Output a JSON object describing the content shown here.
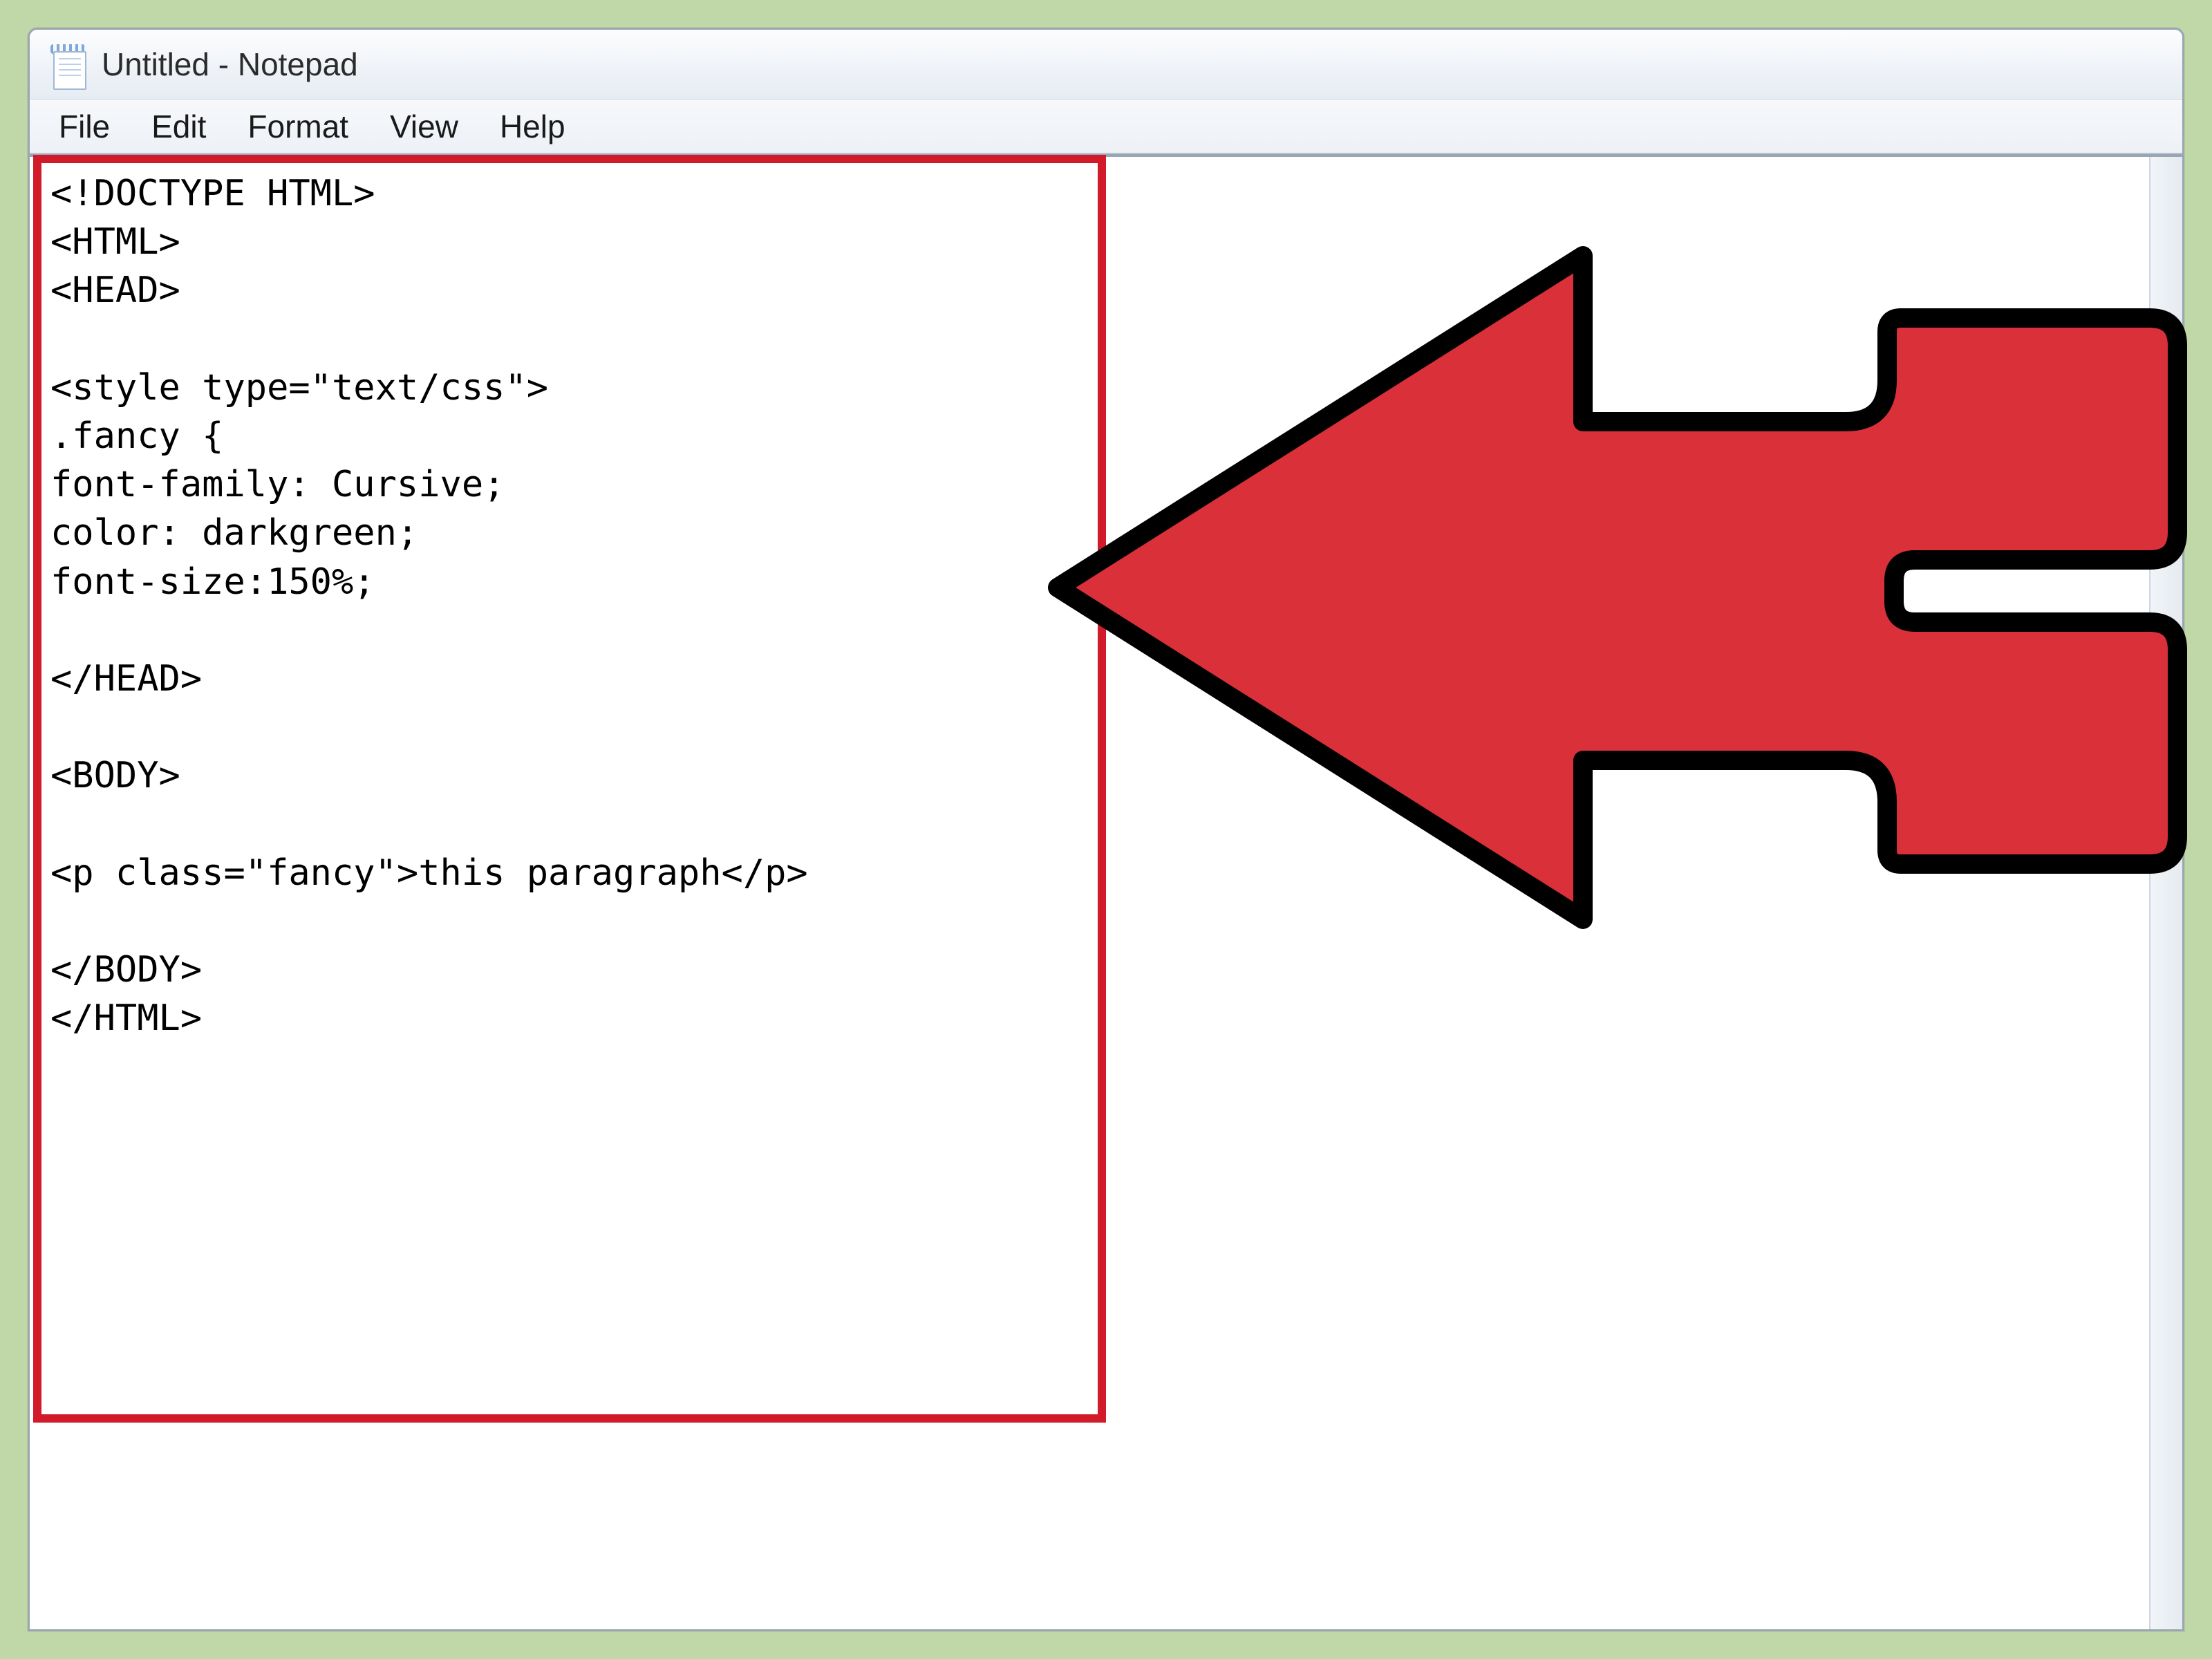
{
  "window": {
    "title": "Untitled - Notepad"
  },
  "menu": {
    "items": [
      "File",
      "Edit",
      "Format",
      "View",
      "Help"
    ]
  },
  "editor": {
    "content": "<!DOCTYPE HTML>\n<HTML>\n<HEAD>\n\n<style type=\"text/css\">\n.fancy {\nfont-family: Cursive;\ncolor: darkgreen;\nfont-size:150%;\n\n</HEAD>\n\n<BODY>\n\n<p class=\"fancy\">this paragraph</p>\n\n</BODY>\n</HTML>"
  },
  "annotation": {
    "highlight_color": "#d11a2a",
    "arrow_color": "#d11a2a"
  }
}
